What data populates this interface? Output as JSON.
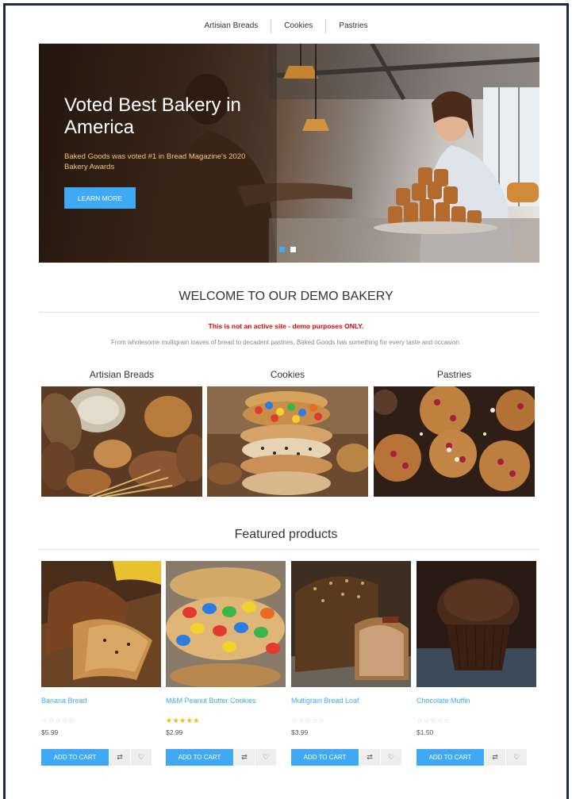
{
  "nav": {
    "items": [
      {
        "label": "Artisian Breads"
      },
      {
        "label": "Cookies"
      },
      {
        "label": "Pastries"
      }
    ]
  },
  "hero": {
    "title": "Voted Best Bakery in America",
    "subtitle": "Baked Goods was voted #1 in Bread Magazine's 2020 Bakery Awards",
    "button_label": "LEARN MORE",
    "slide_count": 2,
    "active_slide": 1
  },
  "welcome": {
    "title": "WELCOME TO OUR DEMO BAKERY",
    "notice": "This is not an active site - demo purposes ONLY.",
    "tagline": "From wholesome multigrain loaves of bread to decadent pastries, Baked Goods has something for every taste and occasion."
  },
  "categories": [
    {
      "label": "Artisian Breads",
      "icon": "bread-photo"
    },
    {
      "label": "Cookies",
      "icon": "cookie-stack-photo"
    },
    {
      "label": "Pastries",
      "icon": "muffin-photo"
    }
  ],
  "featured": {
    "title": "Featured products",
    "products": [
      {
        "name": "Banana Bread",
        "price": "$5.99",
        "stars": "☆☆☆☆☆",
        "rating": 0,
        "cart_label": "ADD TO CART"
      },
      {
        "name": "M&M Peanut Butter Cookies",
        "price": "$2.99",
        "stars": "★★★★★",
        "rating": 5,
        "cart_label": "ADD TO CART"
      },
      {
        "name": "Multigrain Bread Loaf",
        "price": "$3.99",
        "stars": "☆☆☆☆☆",
        "rating": 0,
        "cart_label": "ADD TO CART"
      },
      {
        "name": "Chocolate Muffin",
        "price": "$1.50",
        "stars": "☆☆☆☆☆",
        "rating": 0,
        "cart_label": "ADD TO CART"
      }
    ],
    "compare_icon": "compare-icon",
    "wishlist_icon": "heart-icon"
  },
  "colors": {
    "accent": "#3fa9f5",
    "notice": "#e60000",
    "hero_subtitle": "#f2c879",
    "star": "#f5b800",
    "frame": "#1f2a44"
  }
}
